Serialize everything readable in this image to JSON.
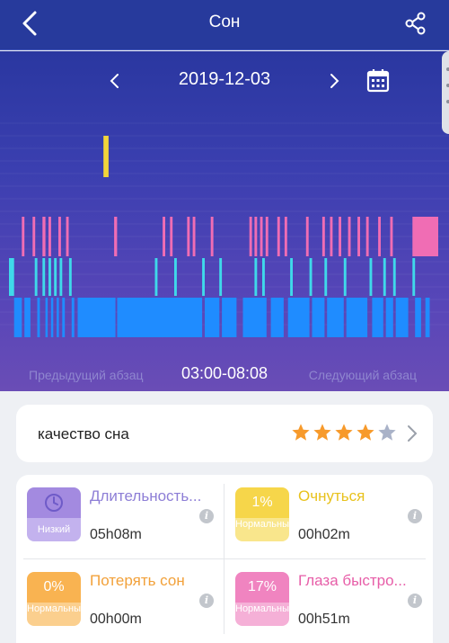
{
  "header": {
    "title": "Сон"
  },
  "date_nav": {
    "date": "2019-12-03"
  },
  "chart_footer": {
    "prev_label": "Предыдущий абзац",
    "range": "03:00-08:08",
    "next_label": "Следующий абзац"
  },
  "quality": {
    "label": "качество сна",
    "rating": 4,
    "max_rating": 5
  },
  "colors": {
    "header": "#273a9c",
    "awake": "#f2d43a",
    "rem": "#f06db4",
    "light": "#3fd9ea",
    "deep": "#1f8cff",
    "star_on": "#f79a2b",
    "star_off": "#a9b2c8"
  },
  "chart_data": {
    "type": "heatmap",
    "x_range": [
      "03:00",
      "08:08"
    ],
    "stages": [
      {
        "name": "awake",
        "segments": [
          [
            0.22,
            0.232
          ]
        ]
      },
      {
        "name": "rem",
        "segments": [
          [
            0.03,
            0.036
          ],
          [
            0.055,
            0.061
          ],
          [
            0.078,
            0.085
          ],
          [
            0.092,
            0.098
          ],
          [
            0.115,
            0.121
          ],
          [
            0.133,
            0.139
          ],
          [
            0.245,
            0.252
          ],
          [
            0.358,
            0.364
          ],
          [
            0.375,
            0.381
          ],
          [
            0.415,
            0.421
          ],
          [
            0.428,
            0.434
          ],
          [
            0.47,
            0.476
          ],
          [
            0.56,
            0.566
          ],
          [
            0.572,
            0.578
          ],
          [
            0.585,
            0.591
          ],
          [
            0.598,
            0.604
          ],
          [
            0.625,
            0.631
          ],
          [
            0.642,
            0.648
          ],
          [
            0.692,
            0.698
          ],
          [
            0.73,
            0.736
          ],
          [
            0.748,
            0.754
          ],
          [
            0.768,
            0.774
          ],
          [
            0.79,
            0.796
          ],
          [
            0.812,
            0.818
          ],
          [
            0.832,
            0.838
          ],
          [
            0.86,
            0.866
          ],
          [
            0.888,
            0.894
          ],
          [
            0.94,
            1.0
          ]
        ]
      },
      {
        "name": "light",
        "segments": [
          [
            0.0,
            0.012
          ],
          [
            0.06,
            0.066
          ],
          [
            0.078,
            0.084
          ],
          [
            0.092,
            0.098
          ],
          [
            0.105,
            0.111
          ],
          [
            0.118,
            0.124
          ],
          [
            0.14,
            0.146
          ],
          [
            0.34,
            0.346
          ],
          [
            0.385,
            0.391
          ],
          [
            0.45,
            0.456
          ],
          [
            0.49,
            0.496
          ],
          [
            0.572,
            0.578
          ],
          [
            0.59,
            0.596
          ],
          [
            0.655,
            0.661
          ],
          [
            0.7,
            0.706
          ],
          [
            0.735,
            0.741
          ],
          [
            0.78,
            0.786
          ],
          [
            0.84,
            0.846
          ],
          [
            0.872,
            0.878
          ],
          [
            0.895,
            0.901
          ],
          [
            0.94,
            0.946
          ]
        ]
      },
      {
        "name": "deep",
        "segments": [
          [
            0.012,
            0.03
          ],
          [
            0.036,
            0.05
          ],
          [
            0.066,
            0.072
          ],
          [
            0.085,
            0.09
          ],
          [
            0.098,
            0.102
          ],
          [
            0.111,
            0.115
          ],
          [
            0.124,
            0.13
          ],
          [
            0.146,
            0.152
          ],
          [
            0.16,
            0.248
          ],
          [
            0.252,
            0.45
          ],
          [
            0.456,
            0.49
          ],
          [
            0.496,
            0.53
          ],
          [
            0.545,
            0.6
          ],
          [
            0.61,
            0.64
          ],
          [
            0.65,
            0.7
          ],
          [
            0.706,
            0.735
          ],
          [
            0.741,
            0.78
          ],
          [
            0.786,
            0.835
          ],
          [
            0.846,
            0.872
          ],
          [
            0.878,
            0.895
          ],
          [
            0.901,
            0.93
          ],
          [
            0.946,
            0.96
          ],
          [
            0.97,
            0.98
          ]
        ]
      }
    ]
  },
  "stats": [
    {
      "name": "Длительность...",
      "value": "05h08m",
      "badge_top": "",
      "badge_bottom": "Низкий",
      "icon": "clock-icon",
      "color": "#a38ae0",
      "light": "#c3b2ee",
      "text_color": "#8d7ed6"
    },
    {
      "name": "Очнуться",
      "value": "00h02m",
      "badge_top": "1%",
      "badge_bottom": "Нормальный",
      "color": "#f6d64a",
      "light": "#f9e68c",
      "text_color": "#e8c21d"
    },
    {
      "name": "Потерять сон",
      "value": "00h00m",
      "badge_top": "0%",
      "badge_bottom": "Нормальный",
      "color": "#f9b351",
      "light": "#fbcf8e",
      "text_color": "#f2a13a"
    },
    {
      "name": "Глаза быстро...",
      "value": "00h51m",
      "badge_top": "17%",
      "badge_bottom": "Нормальный",
      "color": "#f084c0",
      "light": "#f5b0d7",
      "text_color": "#e75ea8"
    }
  ]
}
